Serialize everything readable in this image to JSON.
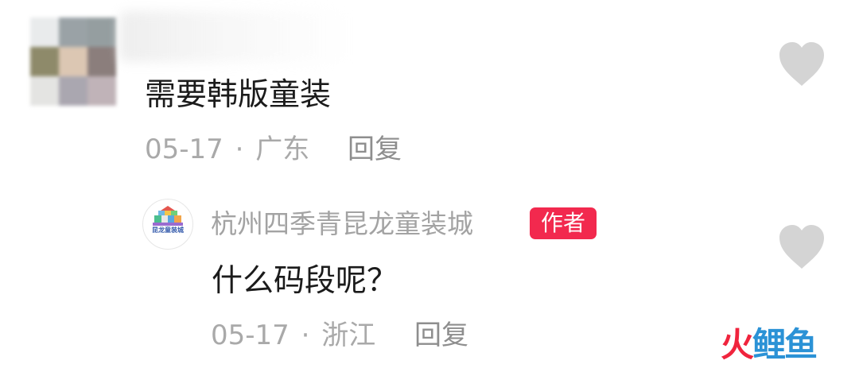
{
  "comment": {
    "text": "需要韩版童装",
    "date": "05-17",
    "separator": "·",
    "location": "广东",
    "reply_label": "回复"
  },
  "reply": {
    "author_name": "杭州四季青昆龙童装城",
    "author_badge": "作者",
    "avatar_caption": "昆龙童装城",
    "text": "什么码段呢？",
    "date": "05-17",
    "separator": "·",
    "location": "浙江",
    "reply_label": "回复"
  },
  "icons": {
    "like": "heart-icon",
    "avatar": "user-avatar-blurred"
  },
  "colors": {
    "badge": "#f2294e",
    "heart": "#d4d4d4",
    "meta_text": "#a9a9a9",
    "watermark_red": "#f0243d",
    "watermark_blue": "#2b92d6"
  },
  "watermark": {
    "part1": "火",
    "part2": "鲤鱼"
  }
}
